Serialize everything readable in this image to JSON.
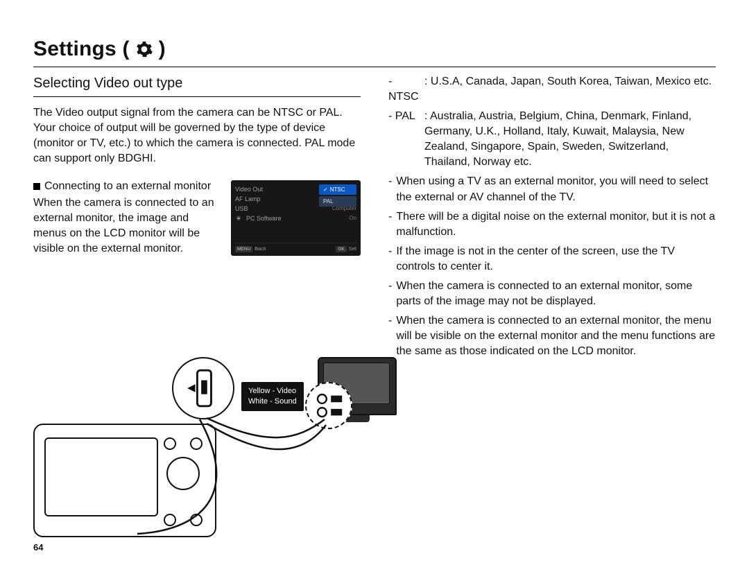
{
  "page_number": "64",
  "title": "Settings (",
  "title_close": ")",
  "subhead": "Selecting Video out type",
  "intro": "The Video output signal from the camera can be NTSC or PAL. Your choice of output will be governed by the type of device (monitor or TV, etc.) to which the camera is connected. PAL mode can support only BDGHI.",
  "connect_head": "Connecting to an external monitor",
  "connect_body": "When the camera is connected to an external monitor, the image and menus on the LCD monitor will be visible on the external monitor.",
  "menu": {
    "items": [
      {
        "label": "Video Out",
        "value": ""
      },
      {
        "label": "AF Lamp",
        "value": ""
      },
      {
        "label": "USB",
        "value": "Computer"
      },
      {
        "label": "PC Software",
        "value": "On"
      }
    ],
    "options": [
      {
        "label": "NTSC",
        "selected": true
      },
      {
        "label": "PAL",
        "selected": false
      }
    ],
    "footer_left_tag": "MENU",
    "footer_left": "Back",
    "footer_right_tag": "OK",
    "footer_right": "Set"
  },
  "legend_line1": "Yellow - Video",
  "legend_line2": "White - Sound",
  "right": {
    "ntsc_label": "- NTSC",
    "ntsc_text": ": U.S.A, Canada, Japan, South Korea, Taiwan, Mexico etc.",
    "pal_label": "- PAL",
    "pal_text": ": Australia, Austria, Belgium, China, Denmark, Finland, Germany, U.K., Holland, Italy, Kuwait, Malaysia, New Zealand, Singapore, Spain, Sweden, Switzerland, Thailand, Norway etc.",
    "notes": [
      "When using a TV as an external monitor, you will need to select the external or AV channel of the TV.",
      "There will be a digital noise on the external monitor, but it is not a malfunction.",
      "If the image is not in the center of the screen, use the TV controls to center it.",
      "When the camera is connected to an external monitor, some parts of the image may not be displayed.",
      "When the camera is connected to an external monitor, the menu will be visible on the external monitor and the menu functions are the same as those indicated on the LCD monitor."
    ]
  }
}
